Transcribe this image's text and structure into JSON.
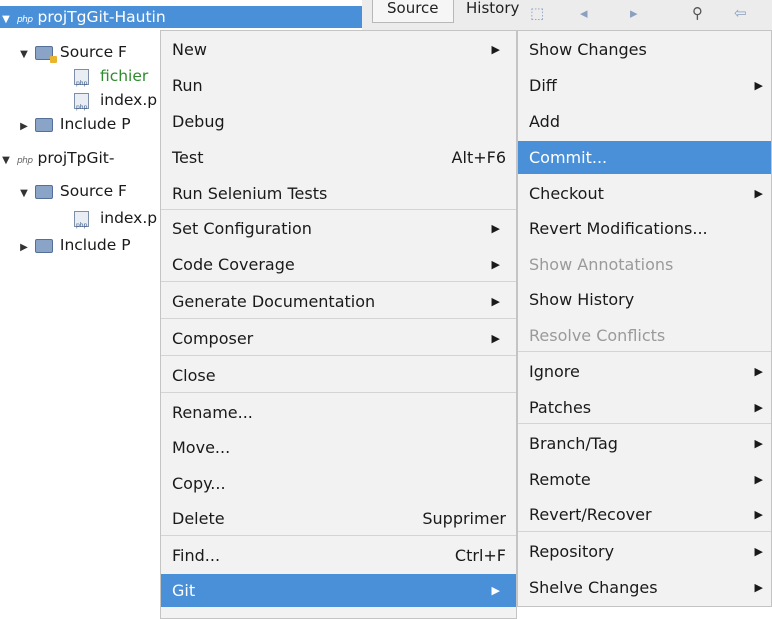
{
  "tree": {
    "project1": "projTgGit-Hautin",
    "source_files": "Source F",
    "file1": "fichier",
    "file2": "index.p",
    "include_path": "Include P",
    "project2": "projTpGit-",
    "source_files2": "Source F",
    "file3": "index.p",
    "include_path2": "Include P"
  },
  "toolbar": {
    "source": "Source",
    "history": "History"
  },
  "context_menu": {
    "new": "New",
    "run": "Run",
    "debug": "Debug",
    "test": "Test",
    "test_shortcut": "Alt+F6",
    "run_selenium": "Run Selenium Tests",
    "set_configuration": "Set Configuration",
    "code_coverage": "Code Coverage",
    "generate_documentation": "Generate Documentation",
    "composer": "Composer",
    "close": "Close",
    "rename": "Rename...",
    "move": "Move...",
    "copy": "Copy...",
    "delete": "Delete",
    "delete_shortcut": "Supprimer",
    "find": "Find...",
    "find_shortcut": "Ctrl+F",
    "git": "Git"
  },
  "git_menu": {
    "show_changes": "Show Changes",
    "diff": "Diff",
    "add": "Add",
    "commit": "Commit...",
    "checkout": "Checkout",
    "revert_modifications": "Revert Modifications...",
    "show_annotations": "Show Annotations",
    "show_history": "Show History",
    "resolve_conflicts": "Resolve Conflicts",
    "ignore": "Ignore",
    "patches": "Patches",
    "branch_tag": "Branch/Tag",
    "remote": "Remote",
    "revert_recover": "Revert/Recover",
    "repository": "Repository",
    "shelve_changes": "Shelve Changes"
  },
  "colors": {
    "highlight": "#4a90d9",
    "menu_bg": "#f2f2f2",
    "disabled": "#9a9a9a",
    "green_text": "#2e8b2e"
  }
}
